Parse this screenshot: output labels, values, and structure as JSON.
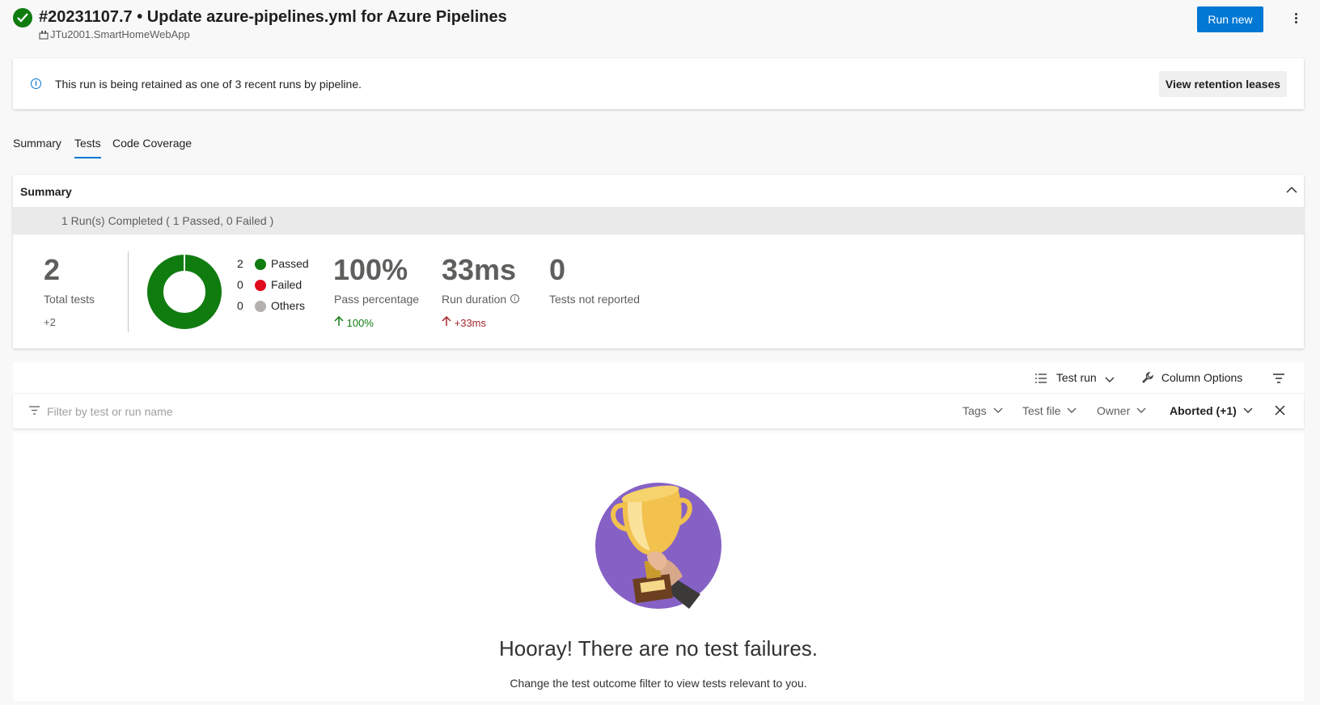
{
  "header": {
    "title": "#20231107.7 • Update azure-pipelines.yml for Azure Pipelines",
    "repo": "JTu2001.SmartHomeWebApp",
    "run_new_label": "Run new",
    "status_icon": "success-check-icon"
  },
  "banner": {
    "text": "This run is being retained as one of 3 recent runs by pipeline.",
    "button_label": "View retention leases"
  },
  "tabs": [
    {
      "label": "Summary",
      "active": false
    },
    {
      "label": "Tests",
      "active": true
    },
    {
      "label": "Code Coverage",
      "active": false
    }
  ],
  "summary": {
    "title": "Summary",
    "runs_completed": "1 Run(s) Completed ( 1 Passed, 0 Failed )",
    "total_tests": "2",
    "total_tests_label": "Total tests",
    "total_tests_delta": "+2",
    "legend": [
      {
        "count": "2",
        "label": "Passed",
        "color": "#107c10"
      },
      {
        "count": "0",
        "label": "Failed",
        "color": "#e00b1c"
      },
      {
        "count": "0",
        "label": "Others",
        "color": "#b3b0ad"
      }
    ],
    "pass_percentage": "100%",
    "pass_percentage_label": "Pass percentage",
    "pass_percentage_delta": "100%",
    "run_duration": "33ms",
    "run_duration_label": "Run duration",
    "run_duration_delta": "+33ms",
    "not_reported": "0",
    "not_reported_label": "Tests not reported",
    "donut_passed_fraction": 1.0
  },
  "toolbar": {
    "test_run_label": "Test run",
    "column_options_label": "Column Options"
  },
  "filter": {
    "placeholder": "Filter by test or run name",
    "tags": "Tags",
    "test_file": "Test file",
    "owner": "Owner",
    "outcome": "Aborted (+1)"
  },
  "empty_state": {
    "headline": "Hooray! There are no test failures.",
    "hint": "Change the test outcome filter to view tests relevant to you."
  },
  "colors": {
    "accent": "#0078d4",
    "passed": "#107c10",
    "failed": "#e00b1c",
    "trophy_bg": "#8661c5"
  }
}
